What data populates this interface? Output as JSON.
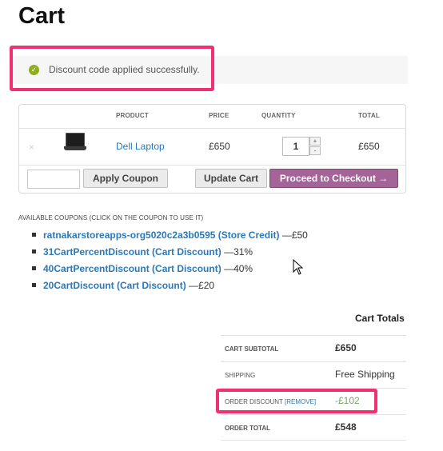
{
  "page": {
    "title": "Cart"
  },
  "notice": {
    "text": "Discount code applied successfully.",
    "icon": "check-circle-icon",
    "color": "#8fae1b"
  },
  "cart_table": {
    "headers": {
      "product": "PRODUCT",
      "price": "PRICE",
      "quantity": "QUANTITY",
      "total": "TOTAL"
    },
    "rows": [
      {
        "remove": "×",
        "product": "Dell Laptop",
        "price": "£650",
        "quantity": "1",
        "total": "£650"
      }
    ],
    "qty_plus": "+",
    "qty_minus": "-",
    "coupon_placeholder": "",
    "apply_coupon": "Apply Coupon",
    "update_cart": "Update Cart",
    "checkout": "Proceed to Checkout →"
  },
  "coupons": {
    "heading": "AVAILABLE COUPONS (CLICK ON THE COUPON TO USE IT)",
    "items": [
      {
        "code": "ratnakarstoreapps-org5020c2a3b0595 (Store Credit)",
        "value": "—£50"
      },
      {
        "code": "31CartPercentDiscount (Cart Discount)",
        "value": "—31%"
      },
      {
        "code": "40CartPercentDiscount (Cart Discount)",
        "value": "—40%"
      },
      {
        "code": "20CartDiscount (Cart Discount)",
        "value": "—£20"
      }
    ]
  },
  "totals": {
    "title": "Cart Totals",
    "subtotal_label": "CART SUBTOTAL",
    "subtotal_value": "£650",
    "shipping_label": "SHIPPING",
    "shipping_value": "Free Shipping",
    "discount_label": "ORDER DISCOUNT",
    "discount_remove": "[REMOVE]",
    "discount_value": "-£102",
    "order_total_label": "ORDER TOTAL",
    "order_total_value": "£548"
  },
  "colors": {
    "accent": "#a46497",
    "link": "#2a78b8",
    "highlight": "#f0306f",
    "discount": "#77a464"
  }
}
